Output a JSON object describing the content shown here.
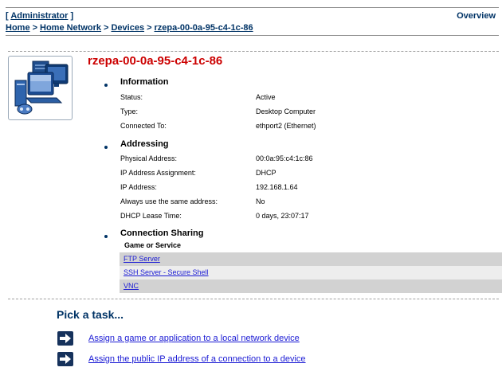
{
  "header": {
    "user_prefix": "[ ",
    "user_label": "Administrator",
    "user_suffix": " ]",
    "overview_label": "Overview"
  },
  "breadcrumb": {
    "items": [
      "Home",
      "Home Network",
      "Devices",
      "rzepa-00-0a-95-c4-1c-86"
    ],
    "separator": ">"
  },
  "device": {
    "title": "rzepa-00-0a-95-c4-1c-86"
  },
  "information": {
    "heading": "Information",
    "rows": [
      {
        "label": "Status:",
        "value": "Active"
      },
      {
        "label": "Type:",
        "value": "Desktop Computer"
      },
      {
        "label": "Connected To:",
        "value": "ethport2 (Ethernet)"
      }
    ]
  },
  "addressing": {
    "heading": "Addressing",
    "rows": [
      {
        "label": "Physical Address:",
        "value": "00:0a:95:c4:1c:86"
      },
      {
        "label": "IP Address Assignment:",
        "value": "DHCP"
      },
      {
        "label": "IP Address:",
        "value": "192.168.1.64"
      },
      {
        "label": "Always use the same address:",
        "value": "No"
      },
      {
        "label": "DHCP Lease Time:",
        "value": "0 days, 23:07:17"
      }
    ]
  },
  "sharing": {
    "heading": "Connection Sharing",
    "column_header": "Game or Service",
    "services": [
      "FTP Server",
      "SSH Server - Secure Shell",
      "VNC"
    ]
  },
  "tasks": {
    "heading": "Pick a task...",
    "items": [
      {
        "label": "Assign a game or application to a local network device",
        "icon": "right-arrow-icon"
      },
      {
        "label": "Assign the public IP address of a connection to a device",
        "icon": "right-arrow-icon"
      }
    ]
  },
  "colors": {
    "accent": "#003366",
    "title_red": "#cc0000",
    "link": "#1a1ad4"
  }
}
